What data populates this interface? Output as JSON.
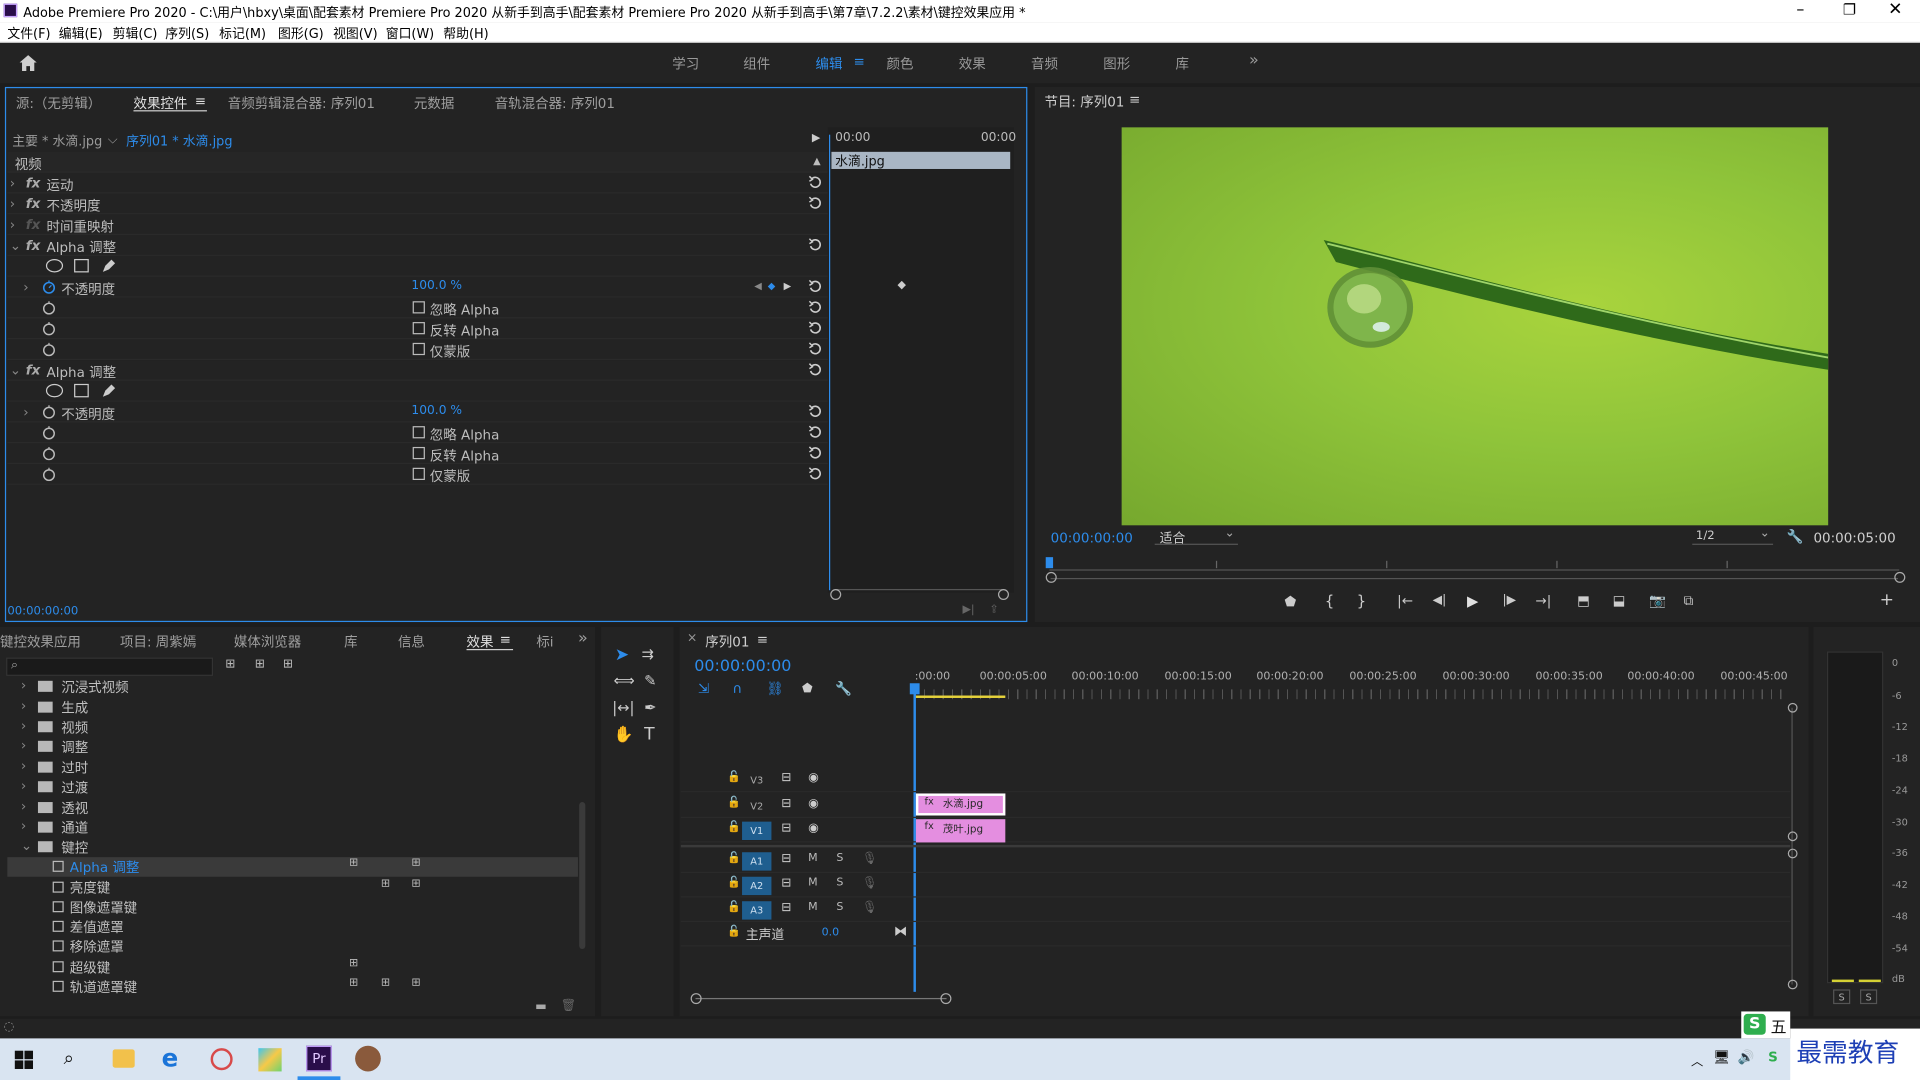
{
  "window": {
    "title": "Adobe Premiere Pro 2020 - C:\\用户\\hbxy\\桌面\\配套素材 Premiere Pro 2020 从新手到高手\\配套素材 Premiere Pro 2020 从新手到高手\\第7章\\7.2.2\\素材\\键控效果应用 *"
  },
  "menu": [
    "文件(F)",
    "编辑(E)",
    "剪辑(C)",
    "序列(S)",
    "标记(M)",
    "图形(G)",
    "视图(V)",
    "窗口(W)",
    "帮助(H)"
  ],
  "workspaces": [
    "学习",
    "组件",
    "编辑",
    "颜色",
    "效果",
    "音频",
    "图形",
    "库"
  ],
  "active_workspace": "编辑",
  "source_panel": {
    "tabs": [
      "源:（无剪辑）",
      "效果控件",
      "音频剪辑混合器: 序列01",
      "元数据",
      "音轨混合器: 序列01"
    ],
    "master_label": "主要 * 水滴.jpg",
    "sequence_label": "序列01 * 水滴.jpg",
    "time_start": "00:00",
    "time_end": "00:00",
    "clip_name": "水滴.jpg",
    "section_video": "视频",
    "effects": {
      "motion": "运动",
      "opacity": "不透明度",
      "time_remap": "时间重映射",
      "alpha_adjust": "Alpha 调整",
      "prop_opacity": "不透明度",
      "opacity_value": "100.0 %",
      "ignore_alpha": "忽略 Alpha",
      "invert_alpha": "反转 Alpha",
      "mask_only": "仅蒙版"
    },
    "timecode": "00:00:00:00"
  },
  "program": {
    "title": "节目: 序列01",
    "timecode": "00:00:00:00",
    "fit": "适合",
    "resolution": "1/2",
    "duration": "00:00:05:00"
  },
  "project_panel": {
    "tabs": [
      "键控效果应用",
      "项目: 周紫嫣",
      "媒体浏览器",
      "库",
      "信息",
      "效果",
      "标i"
    ],
    "active_tab": "效果",
    "folders": [
      "沉浸式视频",
      "生成",
      "视频",
      "调整",
      "过时",
      "过渡",
      "透视",
      "通道",
      "键控"
    ],
    "keying_items": [
      "Alpha 调整",
      "亮度键",
      "图像遮罩键",
      "差值遮罩",
      "移除遮罩",
      "超级键",
      "轨道遮罩键"
    ]
  },
  "timeline": {
    "title": "序列01",
    "timecode": "00:00:00:00",
    "ticks": [
      ":00:00",
      "00:00:05:00",
      "00:00:10:00",
      "00:00:15:00",
      "00:00:20:00",
      "00:00:25:00",
      "00:00:30:00",
      "00:00:35:00",
      "00:00:40:00",
      "00:00:45:00"
    ],
    "tracks_video": [
      "V3",
      "V2",
      "V1"
    ],
    "tracks_audio": [
      "A1",
      "A2",
      "A3"
    ],
    "mute": "M",
    "solo": "S",
    "master": {
      "label": "主声道",
      "value": "0.0"
    },
    "clips": [
      {
        "name": "水滴.jpg"
      },
      {
        "name": "茂叶.jpg"
      }
    ]
  },
  "meter": {
    "ticks": [
      "0",
      "-6",
      "-12",
      "-18",
      "-24",
      "-30",
      "-36",
      "-42",
      "-48",
      "-54",
      "dB"
    ],
    "solo": [
      "S",
      "S"
    ]
  },
  "taskbar": {
    "ime": "五",
    "watermark": "最需教育"
  },
  "colors": {
    "accent": "#2d8ceb",
    "clip_pink": "#e48ee0",
    "panel": "#232323",
    "sky_green": "#8fc43a"
  }
}
